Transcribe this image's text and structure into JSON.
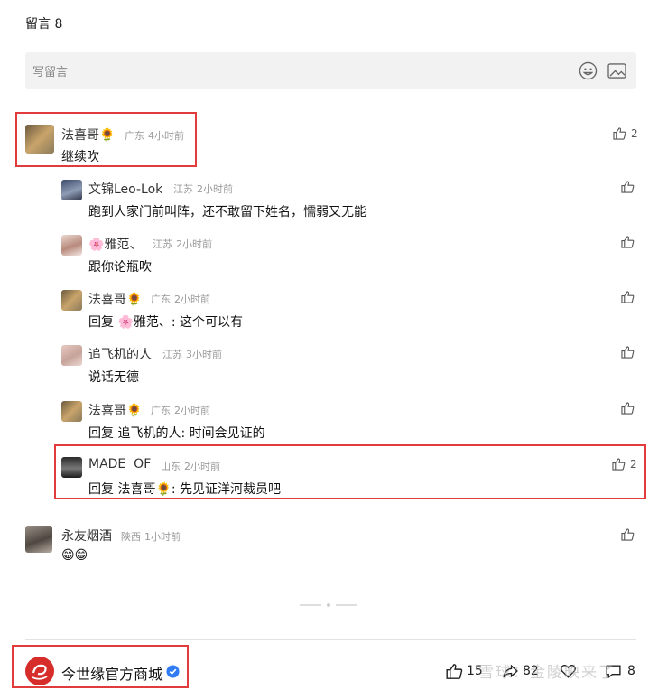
{
  "header": {
    "count_label": "留言 8"
  },
  "compose": {
    "placeholder": "写留言",
    "emoji_icon": "emoji-icon",
    "image_icon": "image-icon"
  },
  "comments": [
    {
      "name": "法喜哥🌻",
      "location": "广东",
      "time": "4小时前",
      "text": "继续吹",
      "likes": "2"
    },
    {
      "name": "文锦Leo-Lok",
      "location": "江苏",
      "time": "2小时前",
      "text": "跑到人家门前叫阵，还不敢留下姓名，懦弱又无能",
      "likes": ""
    },
    {
      "name": "🌸雅范、",
      "location": "江苏",
      "time": "2小时前",
      "text": "跟你论瓶吹",
      "likes": ""
    },
    {
      "name": "法喜哥🌻",
      "location": "广东",
      "time": "2小时前",
      "text": "回复 🌸雅范、: 这个可以有",
      "likes": ""
    },
    {
      "name": "追飞机的人",
      "location": "江苏",
      "time": "3小时前",
      "text": "说话无德",
      "likes": ""
    },
    {
      "name": "法喜哥🌻",
      "location": "广东",
      "time": "2小时前",
      "text": "回复 追飞机的人: 时间会见证的",
      "likes": ""
    },
    {
      "name": "MADE  OF",
      "location": "山东",
      "time": "2小时前",
      "text": "回复 法喜哥🌻: 先见证洋河裁员吧",
      "likes": "2"
    },
    {
      "name": "永友烟酒",
      "location": "陕西",
      "time": "1小时前",
      "text": "😁😁",
      "likes": ""
    }
  ],
  "footer": {
    "brand_name": "今世缘官方商城",
    "like_count": "15",
    "share_count": "82",
    "comment_count": "8",
    "watermark": "雪球：金陵映来了"
  },
  "colors": {
    "highlight": "#e23b3b",
    "brand": "#d72d2a",
    "verified": "#2f7cf6"
  }
}
